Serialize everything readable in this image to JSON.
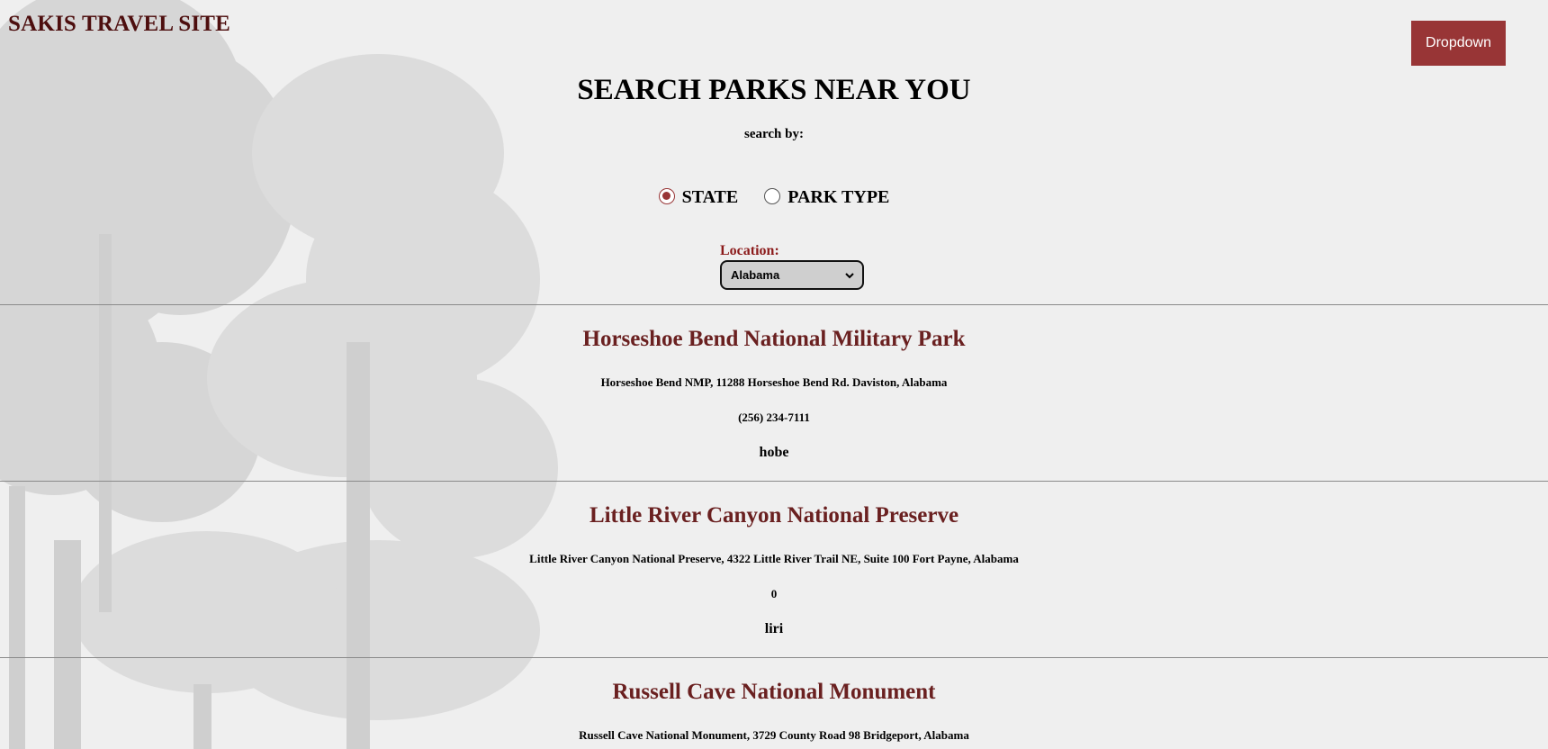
{
  "header": {
    "site_title": "SAKIS TRAVEL SITE",
    "dropdown_label": "Dropdown"
  },
  "search": {
    "heading": "SEARCH PARKS NEAR YOU",
    "search_by_label": "search by:",
    "options": [
      {
        "label": "STATE",
        "selected": true
      },
      {
        "label": "PARK TYPE",
        "selected": false
      }
    ],
    "location_label": "Location:",
    "location_value": "Alabama"
  },
  "parks": [
    {
      "name": "Horseshoe Bend National Military Park",
      "address": "Horseshoe Bend NMP, 11288 Horseshoe Bend Rd. Daviston, Alabama",
      "phone": "(256) 234-7111",
      "code": "hobe"
    },
    {
      "name": "Little River Canyon National Preserve",
      "address": "Little River Canyon National Preserve, 4322 Little River Trail NE, Suite 100 Fort Payne, Alabama",
      "phone": "0",
      "code": "liri"
    },
    {
      "name": "Russell Cave National Monument",
      "address": "Russell Cave National Monument, 3729 County Road 98 Bridgeport, Alabama"
    }
  ],
  "colors": {
    "accent": "#983536",
    "park_title": "#6a2020",
    "site_title": "#4d0e0e",
    "background": "#efefef"
  }
}
